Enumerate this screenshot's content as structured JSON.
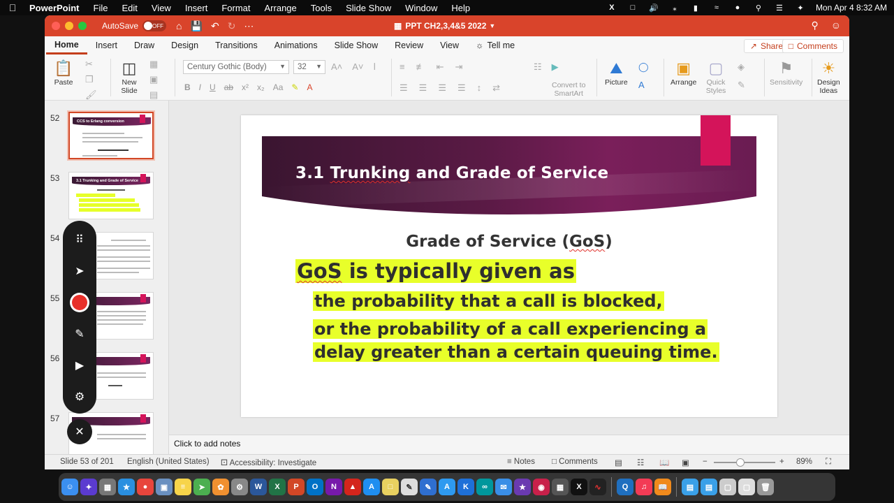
{
  "menubar": {
    "app_name": "PowerPoint",
    "items": [
      "File",
      "Edit",
      "View",
      "Insert",
      "Format",
      "Arrange",
      "Tools",
      "Slide Show",
      "Window",
      "Help"
    ],
    "clock": "Mon Apr 4  8:32 AM"
  },
  "titlebar": {
    "autosave_label": "AutoSave",
    "autosave_state": "OFF",
    "document_title": "PPT CH2,3,4&5  2022"
  },
  "ribbon_tabs": [
    "Home",
    "Insert",
    "Draw",
    "Design",
    "Transitions",
    "Animations",
    "Slide Show",
    "Review",
    "View"
  ],
  "tell_me": "Tell me",
  "share_label": "Share",
  "comments_label": "Comments",
  "ribbon": {
    "paste": "Paste",
    "new_slide": "New\nSlide",
    "font_name": "Century Gothic (Body)",
    "font_size": "32",
    "convert_smartart": "Convert to\nSmartArt",
    "picture": "Picture",
    "arrange": "Arrange",
    "quick_styles": "Quick\nStyles",
    "sensitivity": "Sensitivity",
    "design_ideas": "Design\nIdeas"
  },
  "thumbnails": [
    {
      "number": "52",
      "title": "CCS to Erlang conversion",
      "selected": false
    },
    {
      "number": "53",
      "title": "3.1 Trunking and Grade of Service",
      "selected": true
    },
    {
      "number": "54",
      "title": "",
      "selected": false
    },
    {
      "number": "55",
      "title": "",
      "selected": false
    },
    {
      "number": "56",
      "title": "",
      "selected": false
    },
    {
      "number": "57",
      "title": "",
      "selected": false
    }
  ],
  "slide": {
    "title_prefix": "3.1 ",
    "title_word1": "Trunking",
    "title_suffix": " and Grade of Service",
    "heading_main": "Grade of Service (",
    "heading_gos": "GoS",
    "heading_close": ")",
    "line1_gos": "GoS",
    "line1_rest": " is typically given as",
    "line2": "the probability that a call is blocked,",
    "line3": "or the probability of a call experiencing a",
    "line4": "delay greater than a certain queuing time."
  },
  "notes_placeholder": "Click to add notes",
  "statusbar": {
    "slide_counter": "Slide 53 of 201",
    "language": "English (United States)",
    "accessibility": "Accessibility: Investigate",
    "notes": "Notes",
    "comments": "Comments",
    "zoom": "89%"
  },
  "colors": {
    "ribbon_accent": "#d9442b",
    "slide_banner": "#5a1a45",
    "slide_tab": "#d4145a",
    "highlight": "#e8ff2a"
  }
}
